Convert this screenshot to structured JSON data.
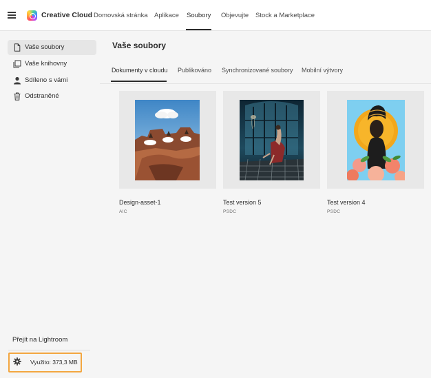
{
  "app": {
    "brand": "Creative Cloud",
    "nav": [
      {
        "label": "Domovská stránka"
      },
      {
        "label": "Aplikace"
      },
      {
        "label": "Soubory"
      },
      {
        "label": "Objevujte"
      },
      {
        "label": "Stock a Marketplace"
      }
    ],
    "active_nav": "Soubory"
  },
  "sidebar": {
    "items": [
      {
        "label": "Vaše soubory",
        "icon": "document-icon"
      },
      {
        "label": "Vaše knihovny",
        "icon": "library-icon"
      },
      {
        "label": "Sdíleno s vámi",
        "icon": "person-icon"
      },
      {
        "label": "Odstraněné",
        "icon": "trash-icon"
      }
    ],
    "selected": "Vaše soubory",
    "lightroom_link": "Přejít na Lightroom",
    "storage_label": "Využito: 373,3 MB"
  },
  "main": {
    "title": "Vaše soubory",
    "tabs": [
      {
        "label": "Dokumenty v cloudu"
      },
      {
        "label": "Publikováno"
      },
      {
        "label": "Synchronizované soubory"
      },
      {
        "label": "Mobilní výtvory"
      }
    ],
    "active_tab": "Dokumenty v cloudu",
    "files": [
      {
        "name": "Design-asset-1",
        "type": "AIC"
      },
      {
        "name": "Test version 5",
        "type": "PSDC"
      },
      {
        "name": "Test version 4",
        "type": "PSDC"
      }
    ]
  },
  "colors": {
    "storage_highlight": "#f3a640",
    "selected_bg": "#e6e6e6"
  }
}
